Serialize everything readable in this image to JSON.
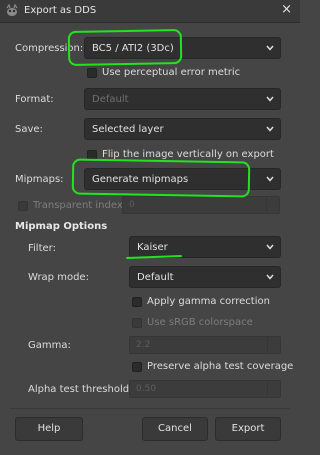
{
  "window": {
    "title": "Export as DDS",
    "close_glyph": "×",
    "icon": "gimp-icon"
  },
  "compression": {
    "label": "Compression:",
    "value": "BC5 / ATI2 (3Dc)"
  },
  "perceptual": {
    "label": "Use perceptual error metric",
    "checked": false
  },
  "format": {
    "label": "Format:",
    "value": "Default",
    "enabled": false
  },
  "save": {
    "label": "Save:",
    "value": "Selected layer"
  },
  "flip": {
    "label": "Flip the image vertically on export",
    "checked": false
  },
  "mipmaps": {
    "label": "Mipmaps:",
    "value": "Generate mipmaps"
  },
  "transparent_index": {
    "label": "Transparent index:",
    "value": "0",
    "enabled": false
  },
  "mipmap_options": {
    "heading": "Mipmap Options",
    "filter": {
      "label": "Filter:",
      "value": "Kaiser"
    },
    "wrap_mode": {
      "label": "Wrap mode:",
      "value": "Default"
    },
    "gamma_correction": {
      "label": "Apply gamma correction",
      "checked": false
    },
    "srgb": {
      "label": "Use sRGB colorspace",
      "checked": false,
      "enabled": false
    },
    "gamma": {
      "label": "Gamma:",
      "value": "2.2",
      "enabled": false
    },
    "preserve_alpha": {
      "label": "Preserve alpha test coverage",
      "checked": false
    },
    "alpha_threshold": {
      "label": "Alpha test threshold:",
      "value": "0.50",
      "enabled": false
    }
  },
  "buttons": {
    "help": "Help",
    "cancel": "Cancel",
    "export": "Export"
  },
  "colors": {
    "background": "#454545",
    "annotation": "#23e31f"
  }
}
